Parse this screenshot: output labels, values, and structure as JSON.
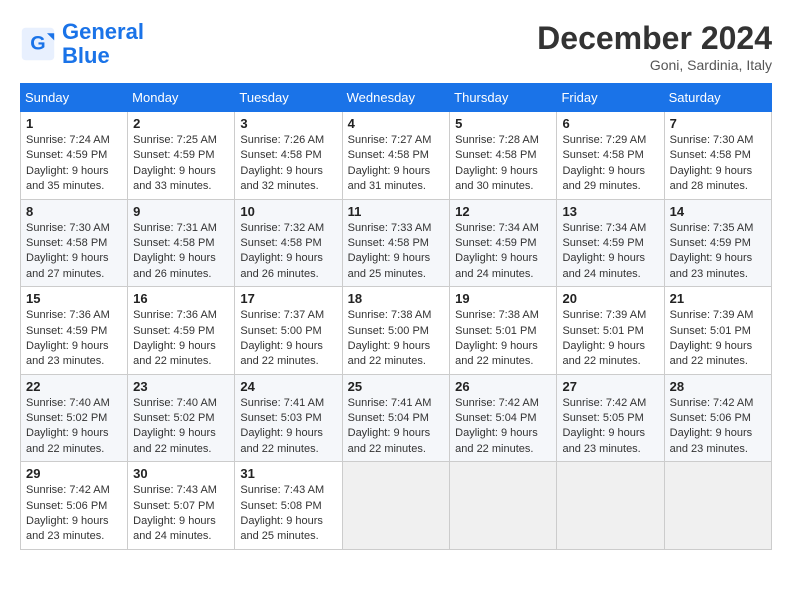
{
  "header": {
    "logo_line1": "General",
    "logo_line2": "Blue",
    "month_title": "December 2024",
    "location": "Goni, Sardinia, Italy"
  },
  "weekdays": [
    "Sunday",
    "Monday",
    "Tuesday",
    "Wednesday",
    "Thursday",
    "Friday",
    "Saturday"
  ],
  "weeks": [
    [
      {
        "day": "1",
        "sunrise": "7:24 AM",
        "sunset": "4:59 PM",
        "daylight": "9 hours and 35 minutes."
      },
      {
        "day": "2",
        "sunrise": "7:25 AM",
        "sunset": "4:59 PM",
        "daylight": "9 hours and 33 minutes."
      },
      {
        "day": "3",
        "sunrise": "7:26 AM",
        "sunset": "4:58 PM",
        "daylight": "9 hours and 32 minutes."
      },
      {
        "day": "4",
        "sunrise": "7:27 AM",
        "sunset": "4:58 PM",
        "daylight": "9 hours and 31 minutes."
      },
      {
        "day": "5",
        "sunrise": "7:28 AM",
        "sunset": "4:58 PM",
        "daylight": "9 hours and 30 minutes."
      },
      {
        "day": "6",
        "sunrise": "7:29 AM",
        "sunset": "4:58 PM",
        "daylight": "9 hours and 29 minutes."
      },
      {
        "day": "7",
        "sunrise": "7:30 AM",
        "sunset": "4:58 PM",
        "daylight": "9 hours and 28 minutes."
      }
    ],
    [
      {
        "day": "8",
        "sunrise": "7:30 AM",
        "sunset": "4:58 PM",
        "daylight": "9 hours and 27 minutes."
      },
      {
        "day": "9",
        "sunrise": "7:31 AM",
        "sunset": "4:58 PM",
        "daylight": "9 hours and 26 minutes."
      },
      {
        "day": "10",
        "sunrise": "7:32 AM",
        "sunset": "4:58 PM",
        "daylight": "9 hours and 26 minutes."
      },
      {
        "day": "11",
        "sunrise": "7:33 AM",
        "sunset": "4:58 PM",
        "daylight": "9 hours and 25 minutes."
      },
      {
        "day": "12",
        "sunrise": "7:34 AM",
        "sunset": "4:59 PM",
        "daylight": "9 hours and 24 minutes."
      },
      {
        "day": "13",
        "sunrise": "7:34 AM",
        "sunset": "4:59 PM",
        "daylight": "9 hours and 24 minutes."
      },
      {
        "day": "14",
        "sunrise": "7:35 AM",
        "sunset": "4:59 PM",
        "daylight": "9 hours and 23 minutes."
      }
    ],
    [
      {
        "day": "15",
        "sunrise": "7:36 AM",
        "sunset": "4:59 PM",
        "daylight": "9 hours and 23 minutes."
      },
      {
        "day": "16",
        "sunrise": "7:36 AM",
        "sunset": "4:59 PM",
        "daylight": "9 hours and 22 minutes."
      },
      {
        "day": "17",
        "sunrise": "7:37 AM",
        "sunset": "5:00 PM",
        "daylight": "9 hours and 22 minutes."
      },
      {
        "day": "18",
        "sunrise": "7:38 AM",
        "sunset": "5:00 PM",
        "daylight": "9 hours and 22 minutes."
      },
      {
        "day": "19",
        "sunrise": "7:38 AM",
        "sunset": "5:01 PM",
        "daylight": "9 hours and 22 minutes."
      },
      {
        "day": "20",
        "sunrise": "7:39 AM",
        "sunset": "5:01 PM",
        "daylight": "9 hours and 22 minutes."
      },
      {
        "day": "21",
        "sunrise": "7:39 AM",
        "sunset": "5:01 PM",
        "daylight": "9 hours and 22 minutes."
      }
    ],
    [
      {
        "day": "22",
        "sunrise": "7:40 AM",
        "sunset": "5:02 PM",
        "daylight": "9 hours and 22 minutes."
      },
      {
        "day": "23",
        "sunrise": "7:40 AM",
        "sunset": "5:02 PM",
        "daylight": "9 hours and 22 minutes."
      },
      {
        "day": "24",
        "sunrise": "7:41 AM",
        "sunset": "5:03 PM",
        "daylight": "9 hours and 22 minutes."
      },
      {
        "day": "25",
        "sunrise": "7:41 AM",
        "sunset": "5:04 PM",
        "daylight": "9 hours and 22 minutes."
      },
      {
        "day": "26",
        "sunrise": "7:42 AM",
        "sunset": "5:04 PM",
        "daylight": "9 hours and 22 minutes."
      },
      {
        "day": "27",
        "sunrise": "7:42 AM",
        "sunset": "5:05 PM",
        "daylight": "9 hours and 23 minutes."
      },
      {
        "day": "28",
        "sunrise": "7:42 AM",
        "sunset": "5:06 PM",
        "daylight": "9 hours and 23 minutes."
      }
    ],
    [
      {
        "day": "29",
        "sunrise": "7:42 AM",
        "sunset": "5:06 PM",
        "daylight": "9 hours and 23 minutes."
      },
      {
        "day": "30",
        "sunrise": "7:43 AM",
        "sunset": "5:07 PM",
        "daylight": "9 hours and 24 minutes."
      },
      {
        "day": "31",
        "sunrise": "7:43 AM",
        "sunset": "5:08 PM",
        "daylight": "9 hours and 25 minutes."
      },
      null,
      null,
      null,
      null
    ]
  ]
}
